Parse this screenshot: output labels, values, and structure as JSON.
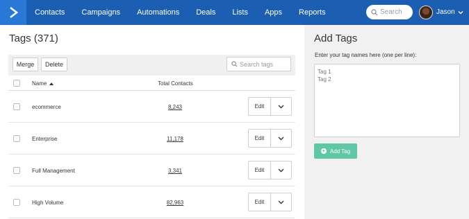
{
  "nav": {
    "logo_icon": "chevron-right-logo-icon",
    "items": [
      {
        "label": "Contacts"
      },
      {
        "label": "Campaigns"
      },
      {
        "label": "Automations"
      },
      {
        "label": "Deals"
      },
      {
        "label": "Lists"
      },
      {
        "label": "Apps"
      },
      {
        "label": "Reports"
      }
    ],
    "search_placeholder": "Search",
    "user_name": "Jason"
  },
  "tags": {
    "title": "Tags (371)",
    "merge_label": "Merge",
    "delete_label": "Delete",
    "search_placeholder": "Search tags",
    "columns": {
      "name": "Name",
      "total": "Total Contacts"
    },
    "rows": [
      {
        "name": "ecommerce",
        "total": "8,243",
        "edit": "Edit"
      },
      {
        "name": "Enterprise",
        "total": "11,178",
        "edit": "Edit"
      },
      {
        "name": "Full Management",
        "total": "3,341",
        "edit": "Edit"
      },
      {
        "name": "High Volume",
        "total": "82,963",
        "edit": "Edit"
      }
    ]
  },
  "add_tags": {
    "title": "Add Tags",
    "help": "Enter your tag names here (one per line):",
    "textarea_placeholder": "Tag 1\nTag 2",
    "button_label": "Add Tag",
    "button_color": "#5fc7a6"
  },
  "colors": {
    "nav_bg": "#1c5fb2",
    "logo_bg": "#2a78d6",
    "side_panel_bg": "#f1f1f1"
  }
}
